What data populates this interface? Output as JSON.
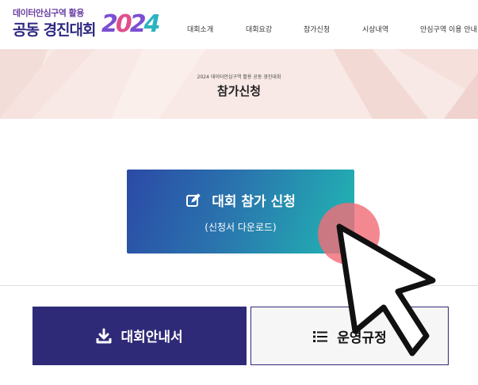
{
  "header": {
    "logo_small": "데이터안심구역 활용",
    "logo_main": "공동 경진대회",
    "logo_year_digits": [
      "2",
      "0",
      "2",
      "4"
    ],
    "nav": [
      {
        "label": "대회소개"
      },
      {
        "label": "대회요강"
      },
      {
        "label": "참가신청"
      },
      {
        "label": "시상내역"
      },
      {
        "label": "안심구역 이용 안내"
      }
    ]
  },
  "banner": {
    "subtitle": "2024 데이터안심구역 활용 공동 경진대회",
    "title": "참가신청"
  },
  "apply": {
    "title": "대회 참가 신청",
    "subtitle": "(신청서 다운로드)",
    "icon": "edit-icon"
  },
  "buttons": {
    "guide": {
      "label": "대회안내서",
      "icon": "download-icon"
    },
    "rules": {
      "label": "운영규정",
      "icon": "list-icon"
    }
  },
  "colors": {
    "brand_navy": "#2f2a77",
    "banner_bg": "#f8e9e6",
    "gradient_start": "#2b4aa6",
    "gradient_end": "#21b8b3",
    "click_highlight": "#f06e78"
  }
}
